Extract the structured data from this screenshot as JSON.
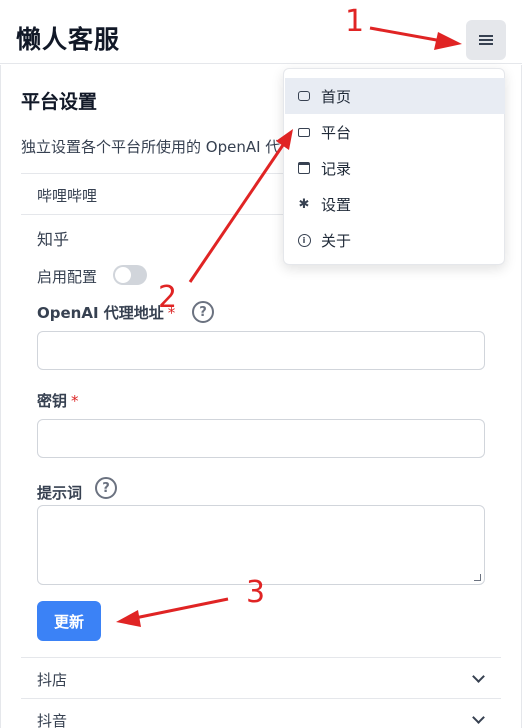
{
  "app": {
    "title": "懒人客服"
  },
  "page": {
    "title": "平台设置",
    "description": "独立设置各个平台所使用的 OpenAI 代"
  },
  "platforms": [
    {
      "label": "哔哩哔哩"
    },
    {
      "label": "知乎"
    },
    {
      "label": "抖店"
    },
    {
      "label": "抖音"
    }
  ],
  "form": {
    "enable_label": "启用配置",
    "enabled": false,
    "proxy_label": "OpenAI 代理地址",
    "proxy_required": "*",
    "proxy_value": "",
    "key_label": "密钥",
    "key_required": "*",
    "key_value": "",
    "prompt_label": "提示词",
    "prompt_value": "",
    "help_glyph": "?",
    "submit_label": "更新"
  },
  "menu": {
    "items": [
      {
        "label": "首页",
        "icon": "chat-bubble-icon",
        "active": true
      },
      {
        "label": "平台",
        "icon": "monitor-icon",
        "active": false
      },
      {
        "label": "记录",
        "icon": "calendar-icon",
        "active": false
      },
      {
        "label": "设置",
        "icon": "gear-icon",
        "glyph": "✱",
        "active": false
      },
      {
        "label": "关于",
        "icon": "info-icon",
        "glyph": "i",
        "active": false
      }
    ]
  },
  "annotations": [
    "1",
    "2",
    "3"
  ],
  "colors": {
    "accent": "#3b82f6",
    "annotation": "#e02424",
    "required": "#dc2626",
    "active_menu_bg": "#e8ecf3"
  }
}
